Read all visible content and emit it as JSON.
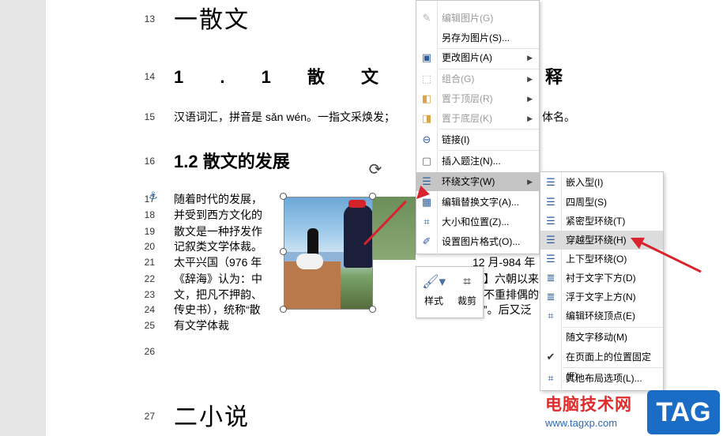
{
  "document": {
    "line_numbers": [
      "13",
      "14",
      "15",
      "16",
      "17",
      "18",
      "19",
      "20",
      "21",
      "22",
      "23",
      "24",
      "25",
      "26",
      "27"
    ],
    "heading_1": "一散文",
    "heading_1_1": "1 . 1 散 文",
    "heading_1_1_tail": "释",
    "para_15": "汉语词汇，拼音是 sǎn wén。一指文采焕发；",
    "para_15_tail": "体名。",
    "heading_1_2": "1.2 散文的发展",
    "body_lines": [
      "随着时代的发展，",
      "并受到西方文化的",
      "散文是一种抒发作",
      "记叙类文学体裁。",
      "太平兴国（976 年",
      "《辞海》认为：中",
      "文，把凡不押韵、",
      "传史书），统称“散",
      "有文学体裁"
    ],
    "right_fragments": [
      "12 月-984 年",
      "】六朝以来，",
      "不重排偶的散",
      "”。后又泛"
    ],
    "heading_2": "二小说"
  },
  "anchor_icon": "anchor-icon",
  "mini_toolbar": {
    "style_label": "样式",
    "crop_label": "裁剪"
  },
  "context_menu": {
    "items": [
      {
        "label": "编辑图片(G)",
        "icon": "edit-picture-icon",
        "disabled": true,
        "submenu": false
      },
      {
        "label": "另存为图片(S)...",
        "icon": "",
        "disabled": false,
        "submenu": false
      },
      {
        "label": "更改图片(A)",
        "icon": "change-picture-icon",
        "disabled": false,
        "submenu": true
      },
      {
        "label": "组合(G)",
        "icon": "group-icon",
        "disabled": true,
        "submenu": true
      },
      {
        "label": "置于顶层(R)",
        "icon": "bring-front-icon",
        "disabled": true,
        "submenu": true
      },
      {
        "label": "置于底层(K)",
        "icon": "send-back-icon",
        "disabled": true,
        "submenu": true
      },
      {
        "label": "链接(I)",
        "icon": "link-icon",
        "disabled": false,
        "submenu": false
      },
      {
        "label": "插入题注(N)...",
        "icon": "caption-icon",
        "disabled": false,
        "submenu": false
      },
      {
        "label": "环绕文字(W)",
        "icon": "wrap-text-icon",
        "disabled": false,
        "submenu": true,
        "highlighted": true
      },
      {
        "label": "编辑替换文字(A)...",
        "icon": "alt-text-icon",
        "disabled": false,
        "submenu": false
      },
      {
        "label": "大小和位置(Z)...",
        "icon": "size-position-icon",
        "disabled": false,
        "submenu": false
      },
      {
        "label": "设置图片格式(O)...",
        "icon": "format-picture-icon",
        "disabled": false,
        "submenu": false
      }
    ]
  },
  "wrap_submenu": {
    "items": [
      {
        "label": "嵌入型(I)",
        "icon": "inline-wrap-icon"
      },
      {
        "label": "四周型(S)",
        "icon": "square-wrap-icon"
      },
      {
        "label": "紧密型环绕(T)",
        "icon": "tight-wrap-icon"
      },
      {
        "label": "穿越型环绕(H)",
        "icon": "through-wrap-icon",
        "hovered": true
      },
      {
        "label": "上下型环绕(O)",
        "icon": "top-bottom-wrap-icon"
      },
      {
        "label": "衬于文字下方(D)",
        "icon": "behind-text-icon"
      },
      {
        "label": "浮于文字上方(N)",
        "icon": "in-front-text-icon"
      },
      {
        "label": "编辑环绕顶点(E)",
        "icon": "edit-wrap-points-icon"
      },
      {
        "label": "随文字移动(M)",
        "icon": ""
      },
      {
        "label": "在页面上的位置固定(F)",
        "icon": "checkmark-icon"
      },
      {
        "label": "其他布局选项(L)...",
        "icon": "more-layout-icon"
      }
    ]
  },
  "watermark": {
    "site_name": "电脑技术网",
    "site_url": "www.tagxp.com",
    "tag": "TAG"
  },
  "colors": {
    "highlight": "#c5c5c5",
    "arrow": "#d9232e",
    "watermark_red": "#e02b2b",
    "tag_blue": "#1a6cc4"
  }
}
